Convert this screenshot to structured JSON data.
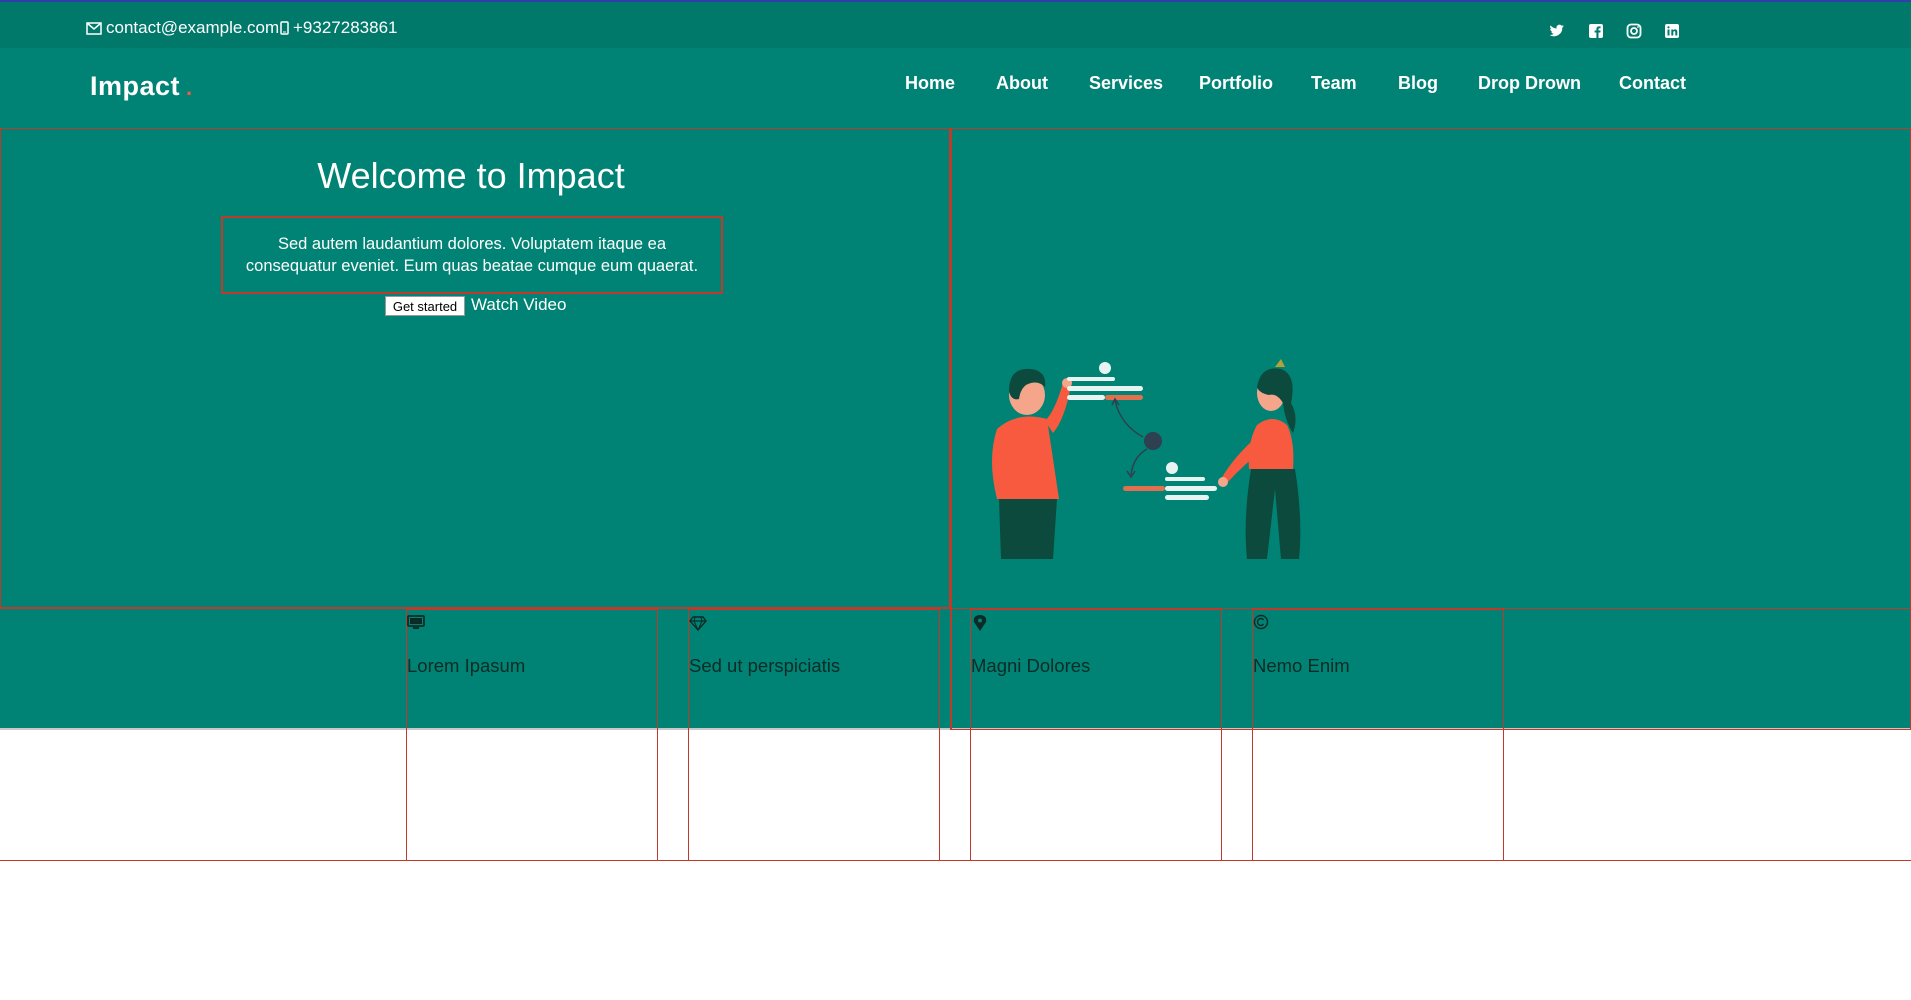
{
  "topbar": {
    "email": "contact@example.com",
    "phone": "+9327283861",
    "social_icons": [
      "twitter-icon",
      "facebook-icon",
      "instagram-icon",
      "linkedin-icon"
    ]
  },
  "header": {
    "logo": "Impact",
    "logo_dot": ".",
    "nav": [
      "Home",
      "About",
      "Services",
      "Portfolio",
      "Team",
      "Blog",
      "Drop Drown",
      "Contact"
    ]
  },
  "hero": {
    "title": "Welcome to Impact",
    "text": "Sed autem laudantium dolores. Voluptatem itaque ea consequatur eveniet. Eum quas beatae cumque eum quaerat.",
    "cta_label": "Get started",
    "video_label": "Watch Video"
  },
  "features": [
    {
      "icon": "monitor-icon",
      "title": "Lorem Ipasum"
    },
    {
      "icon": "gem-icon",
      "title": "Sed ut perspiciatis"
    },
    {
      "icon": "map-pin-icon",
      "title": "Magni Dolores"
    },
    {
      "icon": "copyright-icon",
      "title": "Nemo Enim"
    }
  ],
  "colors": {
    "topbar": "#00796b",
    "primary": "#008374",
    "accent": "#f85a40",
    "outline": "#c0392b"
  }
}
